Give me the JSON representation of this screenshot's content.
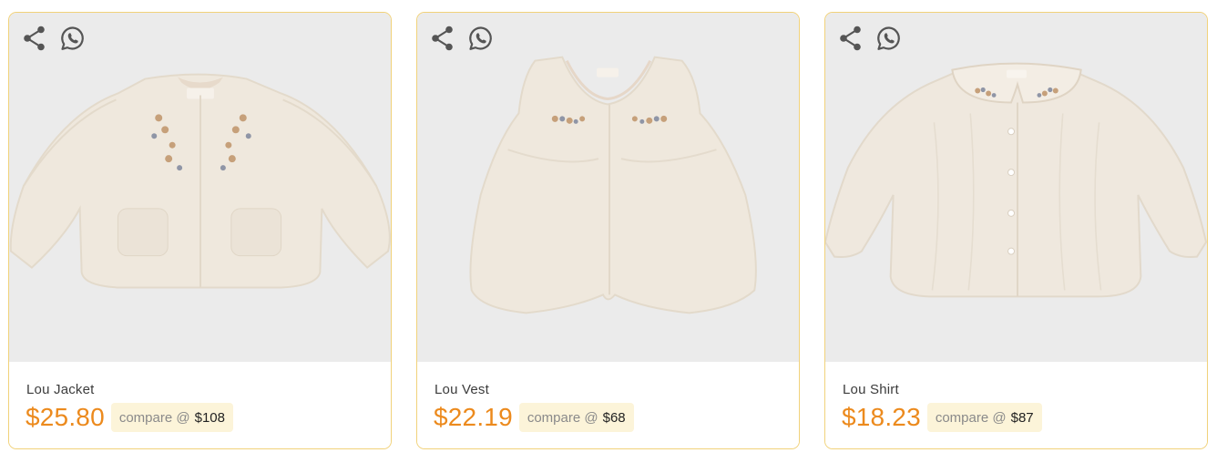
{
  "colors": {
    "card_border": "#f1d27a",
    "price": "#ec8a1d",
    "compare_bg": "#fcf4d9",
    "image_bg": "#ebebeb",
    "icon": "#555555"
  },
  "icons": [
    "share-icon",
    "whatsapp-icon"
  ],
  "products": [
    {
      "name": "Lou Jacket",
      "price": "$25.80",
      "compare_label": "compare @",
      "compare_price": "$108",
      "image": "cream faux-fur baby jacket with floral embroidery"
    },
    {
      "name": "Lou Vest",
      "price": "$22.19",
      "compare_label": "compare @",
      "compare_price": "$68",
      "image": "cream faux-fur baby vest with floral embroidery"
    },
    {
      "name": "Lou Shirt",
      "price": "$18.23",
      "compare_label": "compare @",
      "compare_price": "$87",
      "image": "cream long-sleeve baby shirt with embroidered collar"
    }
  ]
}
